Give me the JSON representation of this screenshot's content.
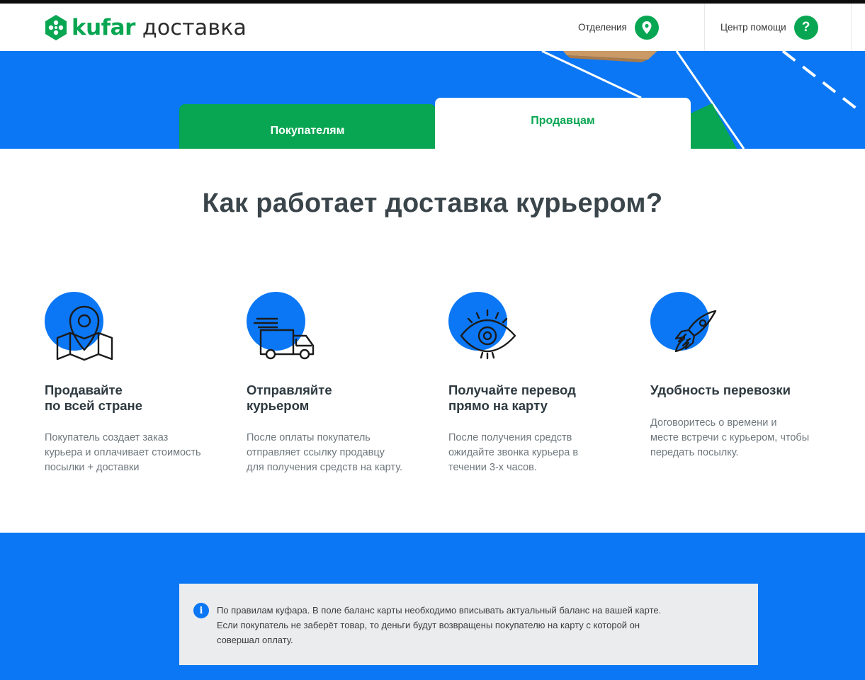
{
  "header": {
    "logo_brand": "kufar",
    "logo_suffix": "доставка",
    "nav": {
      "branches_label": "Отделения",
      "branches_icon": "location-pin-icon",
      "help_label": "Центр помощи",
      "help_icon": "question-icon",
      "help_icon_glyph": "?"
    }
  },
  "tabs": {
    "buyers_label": "Покупателям",
    "sellers_label": "Продавцам",
    "active": "sellers"
  },
  "main": {
    "title": "Как работает доставка курьером?",
    "steps": [
      {
        "icon": "map-pin-icon",
        "title": "Продавайте\nпо всей стране",
        "text": "Покупатель создает заказ\nкурьера и оплачивает стоимость\nпосылки + доставки"
      },
      {
        "icon": "delivery-truck-icon",
        "title": "Отправляйте\nкурьером",
        "text": "После оплаты покупатель\nотправляет ссылку продавцу\nдля получения средств на карту."
      },
      {
        "icon": "eye-icon",
        "title": "Получайте перевод\nпрямо на карту",
        "text": "После получения средств\nожидайте звонка курьера в\nтечении 3-х часов."
      },
      {
        "icon": "rocket-icon",
        "title": "Удобность перевозки",
        "text": "Договоритесь о времени и\nместе встречи с курьером, чтобы\nпередать посылку."
      }
    ]
  },
  "notice": {
    "icon": "info-icon",
    "icon_glyph": "i",
    "text": "По правилам куфара. В поле баланс карты необходимо вписывать актуальный баланс на вашей карте.\nЕсли покупатель не заберёт товар, то деньги будут возвращены покупателю на карту с которой он\nсовершал оплату."
  },
  "colors": {
    "brand_green": "#08a652",
    "brand_blue": "#0b77f5",
    "text_dark": "#2e3a40",
    "notice_bg": "#ebeced"
  }
}
